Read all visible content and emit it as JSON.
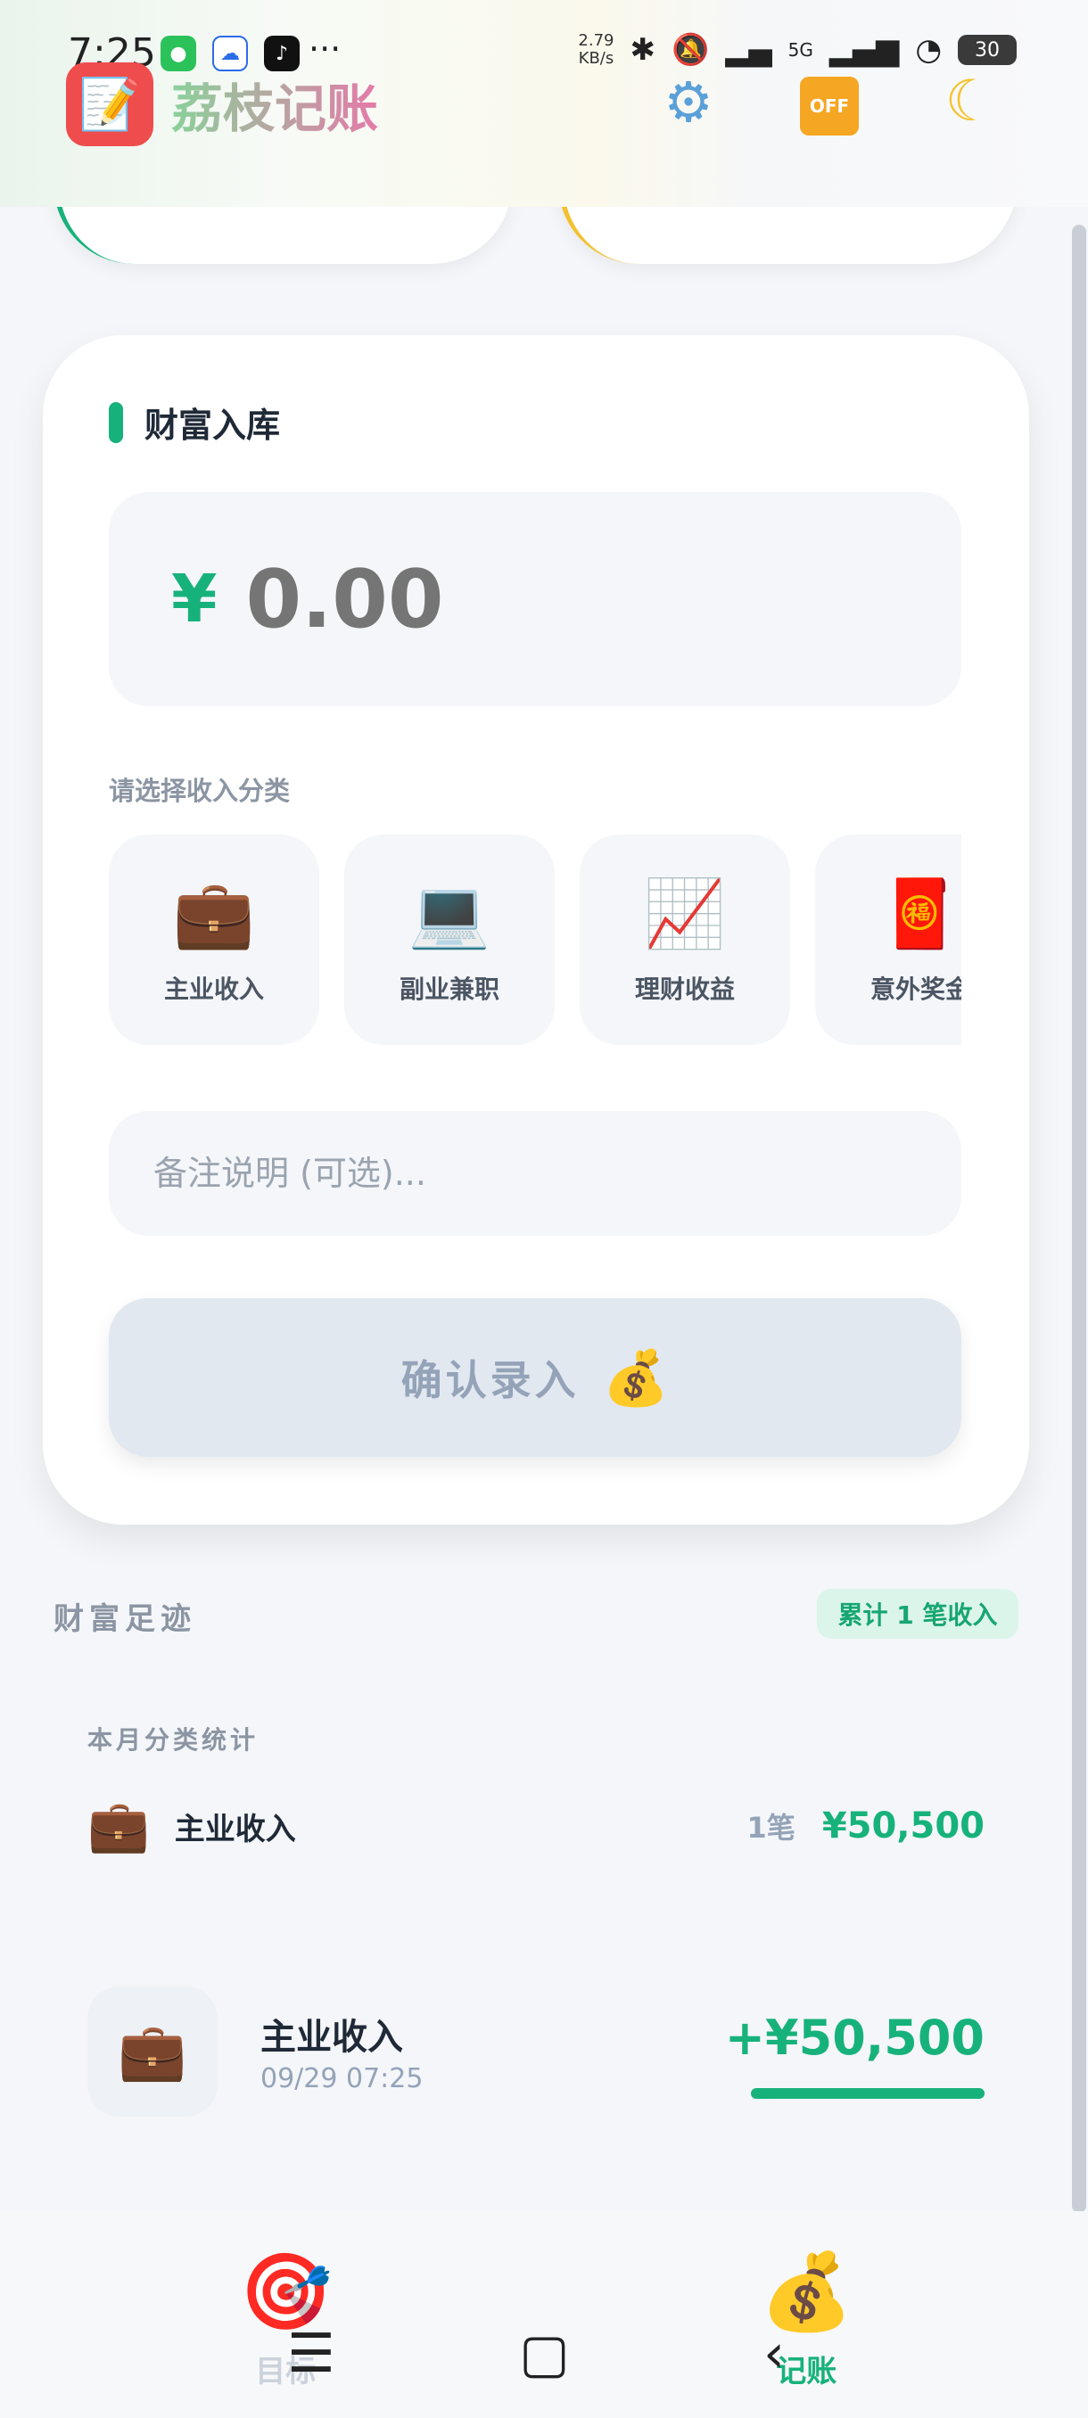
{
  "status_bar": {
    "time": "7:25",
    "net_speed_value": "2.79",
    "net_speed_unit": "KB/s",
    "signal_label": "5G",
    "battery": "30",
    "more": "···"
  },
  "header": {
    "app_name": "荔枝记账",
    "off_label": "OFF"
  },
  "entry": {
    "section_title": "财富入库",
    "currency_symbol": "¥",
    "amount_placeholder": "0.00",
    "category_prompt": "请选择收入分类",
    "categories": [
      {
        "icon": "💼",
        "label": "主业收入"
      },
      {
        "icon": "💻",
        "label": "副业兼职"
      },
      {
        "icon": "📈",
        "label": "理财收益"
      },
      {
        "icon": "🧧",
        "label": "意外奖金"
      }
    ],
    "note_placeholder": "备注说明 (可选)...",
    "confirm_label": "确认录入",
    "confirm_icon": "💰"
  },
  "footprint": {
    "title": "财富足迹",
    "badge": "累计 1 笔收入",
    "stats_title": "本月分类统计",
    "stats": [
      {
        "icon": "💼",
        "name": "主业收入",
        "count": "1笔",
        "amount": "¥50,500"
      }
    ],
    "records": [
      {
        "icon": "💼",
        "name": "主业收入",
        "time": "09/29 07:25",
        "amount": "+¥50,500"
      }
    ]
  },
  "nav": {
    "items": [
      {
        "icon": "🎯",
        "label": "目标",
        "active": false
      },
      {
        "icon": "💰",
        "label": "记账",
        "active": true
      }
    ]
  },
  "colors": {
    "accent": "#17b27b",
    "badge_bg": "#dcf5ea",
    "disabled_button": "#e2e8f0"
  }
}
